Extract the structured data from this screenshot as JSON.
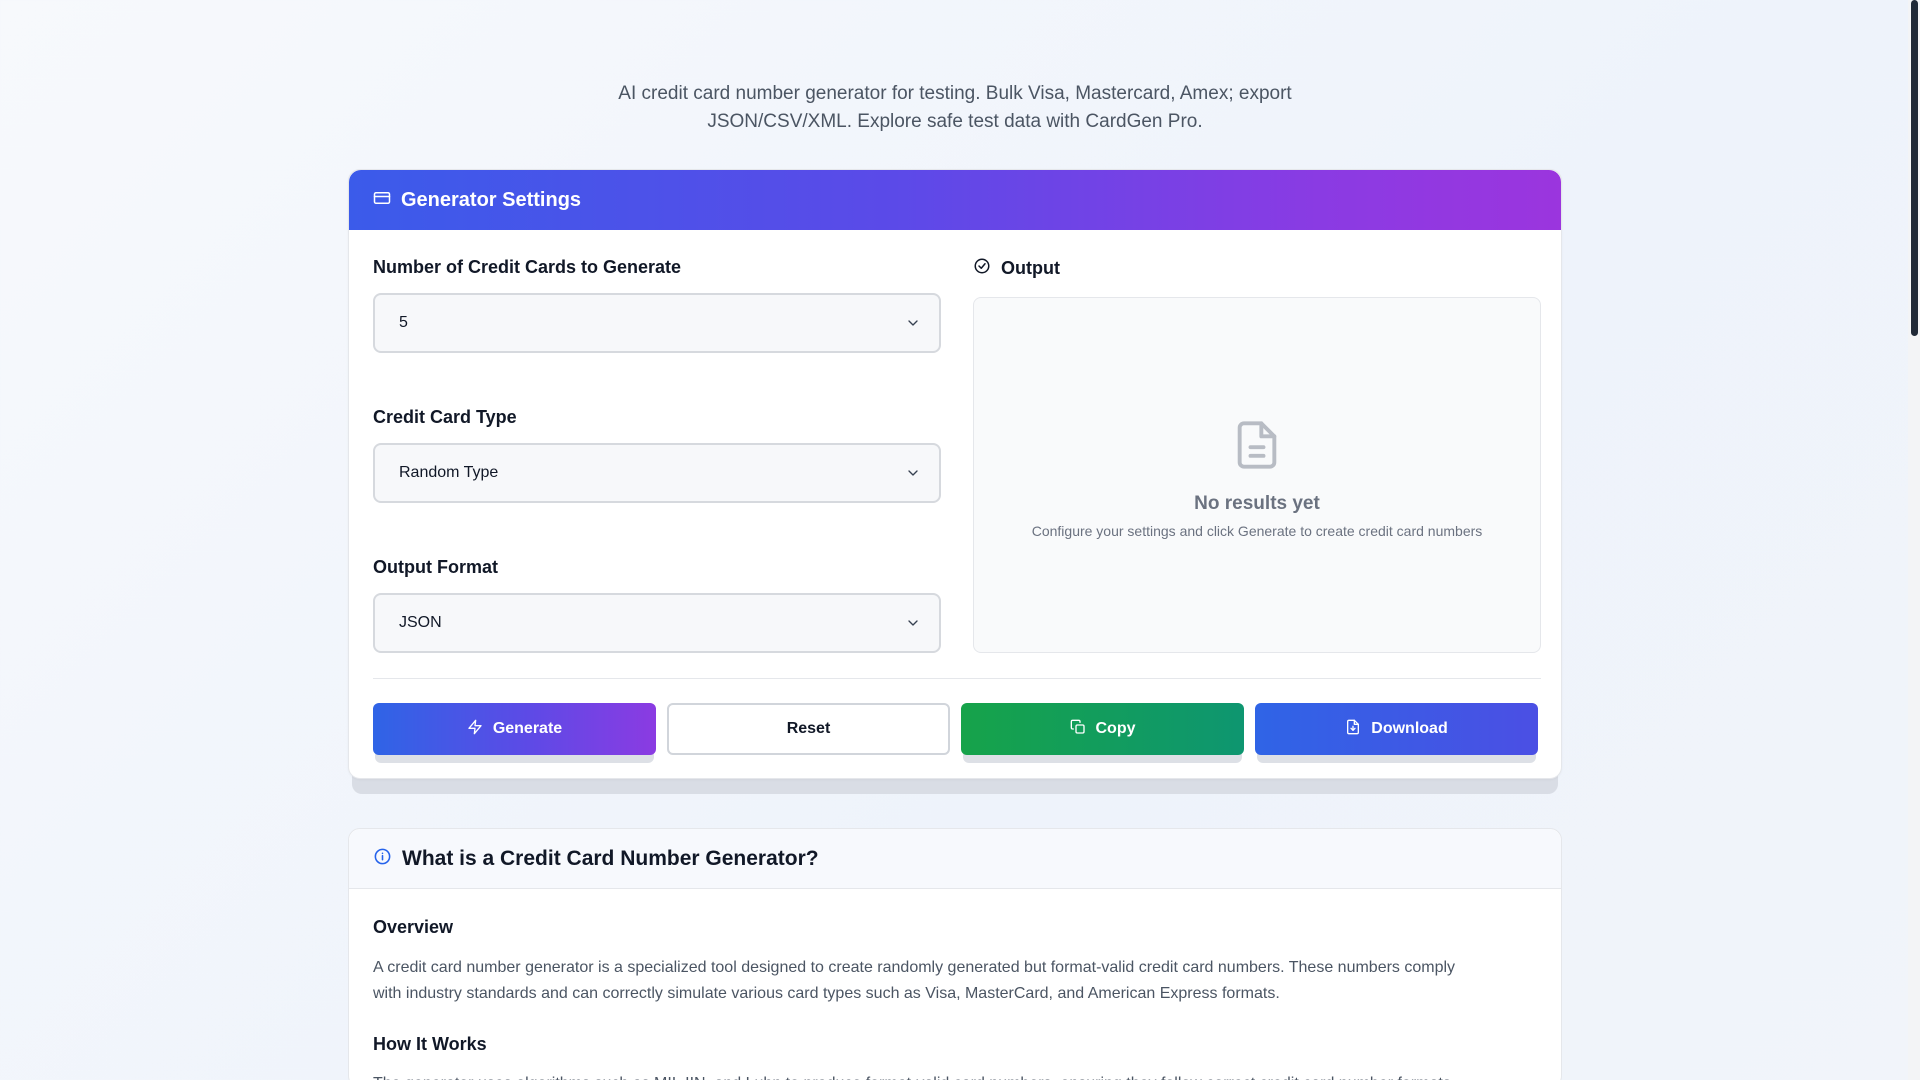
{
  "page": {
    "subtitle_line1": "AI credit card number generator for testing. Bulk Visa, Mastercard, Amex; export",
    "subtitle_line2": "JSON/CSV/XML. Explore safe test data with CardGen Pro."
  },
  "settings": {
    "header_title": "Generator Settings",
    "count": {
      "label": "Number of Credit Cards to Generate",
      "value": "5"
    },
    "card_type": {
      "label": "Credit Card Type",
      "value": "Random Type"
    },
    "format": {
      "label": "Output Format",
      "value": "JSON"
    },
    "output": {
      "label": "Output",
      "empty_title": "No results yet",
      "empty_text": "Configure your settings and click Generate to create credit card numbers"
    },
    "buttons": {
      "generate": "Generate",
      "reset": "Reset",
      "copy": "Copy",
      "download": "Download"
    }
  },
  "info": {
    "header_title": "What is a Credit Card Number Generator?",
    "overview_title": "Overview",
    "overview_line1": "A credit card number generator is a specialized tool designed to create randomly generated but format-valid credit card numbers. These numbers comply",
    "overview_line2": "with industry standards and can correctly simulate various card types such as Visa, MasterCard, and American Express formats.",
    "how_title": "How It Works",
    "how_line1": "The generator uses algorithms such as MII, IIN, and Luhn to produce format-valid card numbers, ensuring they follow correct credit card number formats."
  },
  "colors": {
    "header_gradient_start": "#3b5bea",
    "header_gradient_end": "#9b35de",
    "copy_green": "#16a34a",
    "download_blue": "#2f64e6"
  }
}
